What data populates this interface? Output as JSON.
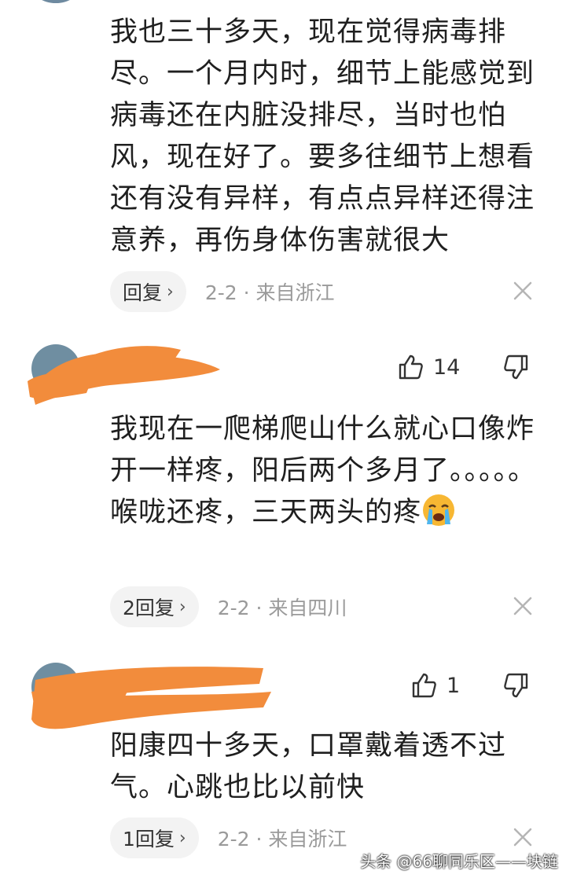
{
  "comments": [
    {
      "text": "我也三十多天，现在觉得病毒排尽。一个月内时，细节上能感觉到病毒还在内脏没排尽，当时也怕风，现在好了。要多往细节上想看还有没有异样，有点点异样还得注意养，再伤身体伤害就很大",
      "reply_label": "回复",
      "date": "2-2",
      "location": "来自浙江"
    },
    {
      "likes": "14",
      "text": "我现在一爬梯爬山什么就心口像炸开一样疼，阳后两个多月了。。。。。喉咙还疼，三天两头的疼",
      "reply_label": "2回复",
      "date": "2-2",
      "location": "来自四川"
    },
    {
      "likes": "1",
      "text": "阳康四十多天，口罩戴着透不过气。心跳也比以前快",
      "reply_label": "1回复",
      "date": "2-2",
      "location": "来自浙江"
    }
  ],
  "separator": "·",
  "watermark": "头条 @66聊同乐区——块链",
  "colors": {
    "redaction": "#f28c3c",
    "meta_gray": "#9a9a9a",
    "reply_bg": "#f3f3f3"
  },
  "icons": [
    "thumbs-up-icon",
    "thumbs-down-icon",
    "close-icon",
    "chevron-right-icon",
    "crying-face-emoji"
  ]
}
